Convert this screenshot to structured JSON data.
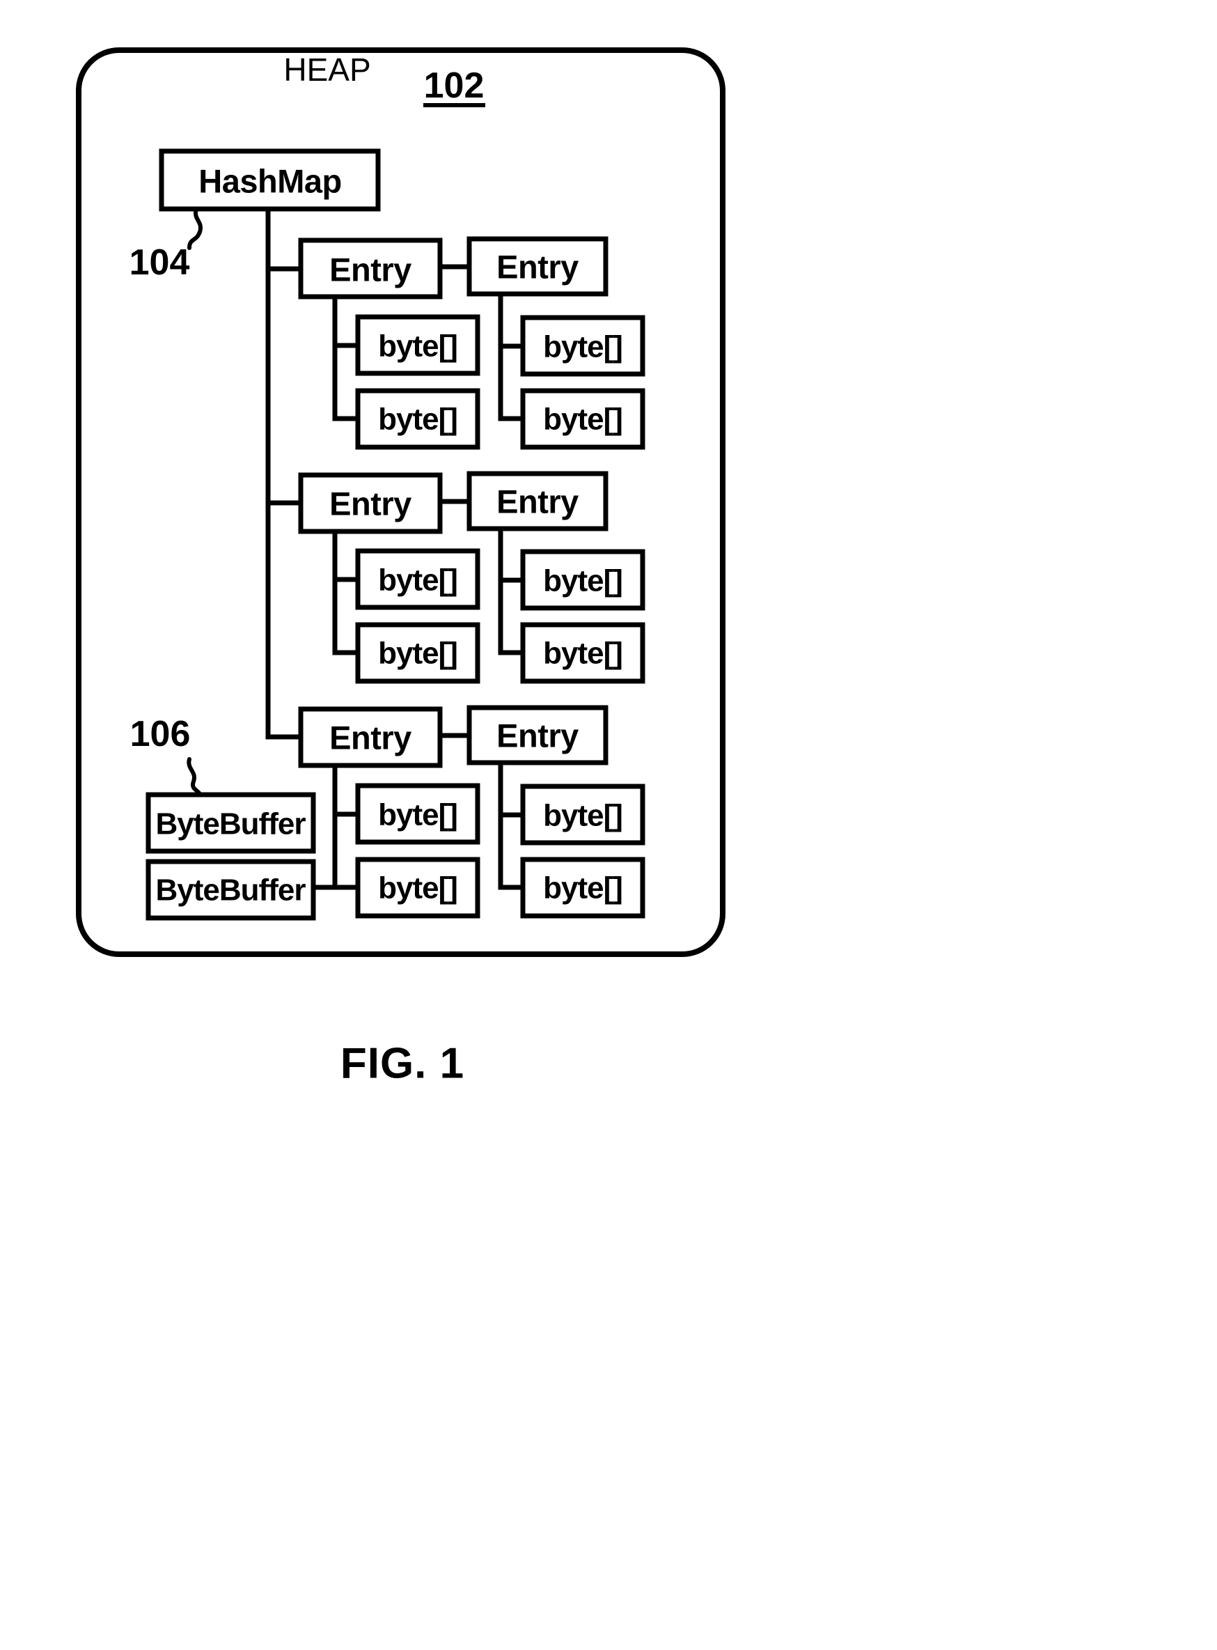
{
  "figure": {
    "caption": "FIG. 1",
    "container_label": "HEAP",
    "container_ref": "102",
    "hashmap_ref": "104",
    "bytebuffer_ref": "106"
  },
  "labels": {
    "hashmap": "HashMap",
    "entry": "Entry",
    "byte_array": "byte[]",
    "bytebuffer": "ByteBuffer"
  },
  "diagram": {
    "root": {
      "name": "HashMap",
      "ref": "104"
    },
    "rows": [
      {
        "id": "row-1",
        "entries": [
          {
            "name": "Entry",
            "children": [
              "byte[]",
              "byte[]"
            ]
          },
          {
            "name": "Entry",
            "children": [
              "byte[]",
              "byte[]"
            ]
          }
        ]
      },
      {
        "id": "row-2",
        "entries": [
          {
            "name": "Entry",
            "children": [
              "byte[]",
              "byte[]"
            ]
          },
          {
            "name": "Entry",
            "children": [
              "byte[]",
              "byte[]"
            ]
          }
        ]
      },
      {
        "id": "row-3",
        "entries": [
          {
            "name": "Entry",
            "children": [
              "byte[]",
              "byte[]"
            ]
          },
          {
            "name": "Entry",
            "children": [
              "byte[]",
              "byte[]"
            ]
          }
        ],
        "buffers": [
          "ByteBuffer",
          "ByteBuffer"
        ],
        "buffers_ref": "106"
      }
    ]
  },
  "colors": {
    "stroke": "#000000",
    "fill": "#ffffff",
    "background": "#ffffff"
  }
}
